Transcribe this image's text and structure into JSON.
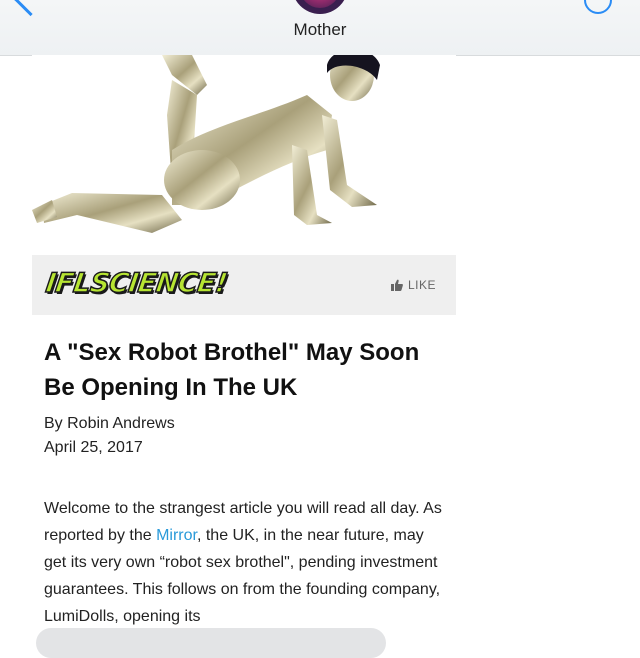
{
  "header": {
    "contact_name": "Mother"
  },
  "card": {
    "brand": "IFLSCIENCE!",
    "like_label": "LIKE",
    "headline": "A \"Sex Robot Brothel\" May Soon Be Opening In The UK",
    "byline": "By Robin Andrews",
    "date": "April 25, 2017",
    "body": {
      "before_link": "Welcome to the strangest article you will read all day. As reported by the ",
      "link_text": "Mirror",
      "after_link": ", the UK, in the near future, may get its very own “robot sex brothel\", pending investment guarantees. This follows on from the founding company, LumiDolls, opening its"
    }
  },
  "colors": {
    "accent": "#2a8cf5",
    "link": "#2a9ad9",
    "brand_green": "#b7e532",
    "bar_bg": "#efefef"
  }
}
